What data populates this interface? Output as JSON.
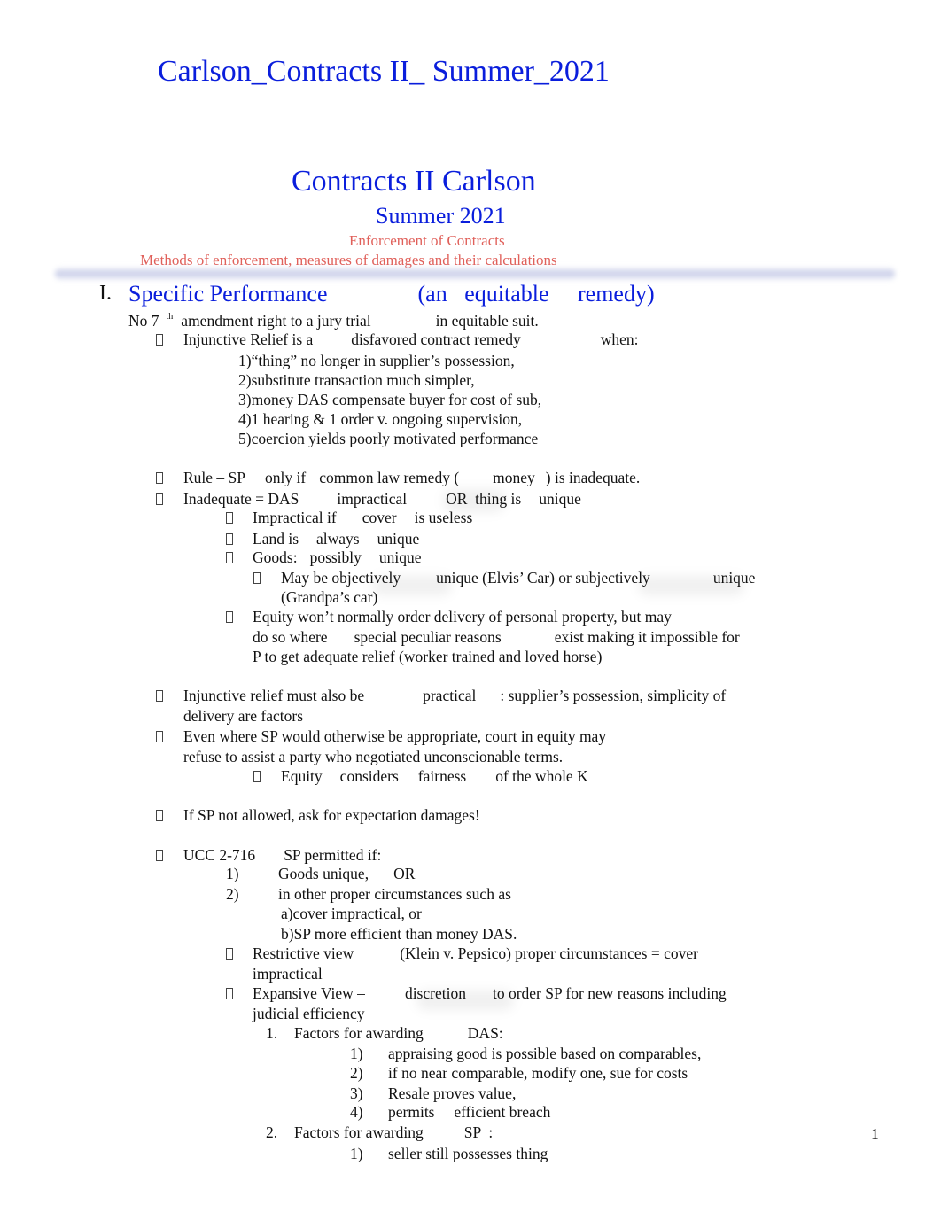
{
  "document": {
    "file_title": "Carlson_Contracts II_ Summer_2021",
    "title": "Contracts II Carlson",
    "subtitle": "Summer 2021",
    "topic": "Enforcement of Contracts",
    "description": "Methods of enforcement, measures of damages and their calculations",
    "page_number": "1"
  },
  "section": {
    "number": "I.",
    "title": "Specific Performance",
    "title_paren": "(an   equitable     remedy)"
  },
  "lines": {
    "jury_a": "No 7",
    "jury_sup": "th",
    "jury_b": "amendment right to a jury trial",
    "jury_c": "in equitable suit.",
    "injunctive_a": "Injunctive Relief is a",
    "injunctive_b": "disfavored contract remedy",
    "injunctive_c": "when:",
    "reasons": [
      "1)“thing” no longer in supplier’s possession,",
      "2)substitute transaction much simpler,",
      "3)money DAS compensate buyer for cost of sub,",
      "4)1 hearing & 1 order v. ongoing supervision,",
      "5)coercion yields poorly motivated performance"
    ],
    "rule_a": "Rule – SP",
    "rule_b": "only if",
    "rule_c": "common law remedy (",
    "rule_d": "money",
    "rule_e": ") is inadequate.",
    "inadequate_a": "Inadequate = DAS",
    "inadequate_b": "impractical",
    "inadequate_c": "OR  thing is",
    "inadequate_d": "unique",
    "impractical_a": "Impractical if",
    "impractical_b": "cover",
    "impractical_c": "is useless",
    "land_a": "Land is",
    "land_b": "always",
    "land_c": "unique",
    "goods_a": "Goods:",
    "goods_b": "possibly",
    "goods_c": "unique",
    "objective_a": "May be objectively",
    "objective_b": "unique (Elvis’ Car) or subjectively",
    "objective_c": "unique",
    "objective_d": "(Grandpa’s car)",
    "equity_1": "Equity won’t normally order delivery of personal property, but may",
    "equity_2a": "do so where",
    "equity_2b": "special peculiar reasons",
    "equity_2c": "exist making it impossible for",
    "equity_3": "P to get adequate relief (worker trained and loved horse)",
    "practical_a": "Injunctive relief must also be",
    "practical_b": "practical",
    "practical_c": ": supplier’s possession, simplicity of",
    "practical_d": "delivery are factors",
    "even_1": "Even where SP would otherwise be appropriate, court in equity may",
    "even_2": "refuse to assist a party who negotiated unconscionable terms.",
    "fair_a": "Equity",
    "fair_b": "considers",
    "fair_c": "fairness",
    "fair_d": "of the whole K",
    "expect": "If SP not allowed, ask for expectation damages!",
    "ucc_a": "UCC 2-716",
    "ucc_b": "SP permitted if:",
    "ucc_items": [
      {
        "num": "1)",
        "text": "Goods unique,",
        "extra": "OR"
      },
      {
        "num": "2)",
        "text": "in other proper circumstances such as",
        "extra": ""
      }
    ],
    "ucc_sub": [
      "a)cover impractical, or",
      "b)SP more efficient than money DAS."
    ],
    "restrictive_a": "Restrictive view",
    "restrictive_b": "(Klein v. Pepsico) proper circumstances = cover",
    "restrictive_c": "impractical",
    "expansive_a": "Expansive View –",
    "expansive_b": "discretion",
    "expansive_c": "to order SP for new reasons including",
    "expansive_d": "judicial efficiency",
    "factors_das_num": "1.",
    "factors_das_a": "Factors for awarding",
    "factors_das_b": "DAS:",
    "factors_das_items": [
      {
        "num": "1)",
        "text": "appraising good is possible based on comparables,"
      },
      {
        "num": "2)",
        "text": "if no near comparable, modify one, sue for costs"
      },
      {
        "num": "3)",
        "text": "Resale proves value,"
      },
      {
        "num": "4)",
        "text": "permits     efficient breach"
      }
    ],
    "factors_sp_num": "2.",
    "factors_sp_a": "Factors for awarding",
    "factors_sp_b": "SP  :",
    "factors_sp_items": [
      {
        "num": "1)",
        "text": "seller still possesses thing"
      }
    ]
  },
  "colors": {
    "heading_blue": "#0a1edc",
    "subheading_red": "#e0605a",
    "body_text": "#111111"
  }
}
